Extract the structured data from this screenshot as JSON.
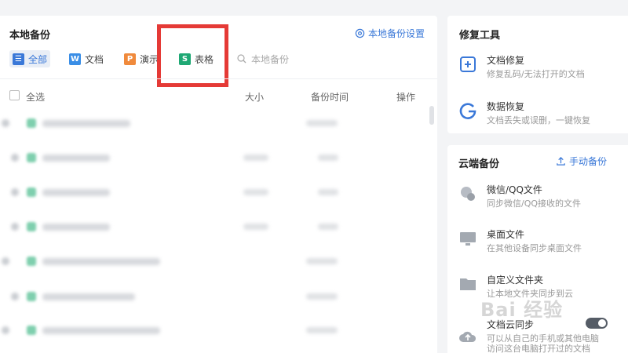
{
  "main": {
    "title": "本地备份",
    "settings_link": "本地备份设置",
    "tabs": [
      {
        "label": "全部",
        "icon_letter": "☰",
        "color": "#3a78d8",
        "active": true
      },
      {
        "label": "文档",
        "icon_letter": "W",
        "color": "#3a8ee6",
        "active": false
      },
      {
        "label": "演示",
        "icon_letter": "P",
        "color": "#f08a3c",
        "active": false
      },
      {
        "label": "表格",
        "icon_letter": "S",
        "color": "#1fa874",
        "active": false
      }
    ],
    "search_placeholder": "本地备份",
    "columns": {
      "select_all": "全选",
      "size": "大小",
      "time": "备份时间",
      "action": "操作"
    }
  },
  "repair": {
    "title": "修复工具",
    "items": [
      {
        "name": "文档修复",
        "desc": "修复乱码/无法打开的文档",
        "icon": "document-repair-icon"
      },
      {
        "name": "数据恢复",
        "desc": "文档丢失或误删，一键恢复",
        "icon": "data-recovery-icon"
      }
    ]
  },
  "cloud": {
    "title": "云端备份",
    "manual_link": "手动备份",
    "items": [
      {
        "name": "微信/QQ文件",
        "desc": "同步微信/QQ接收的文件",
        "icon": "chat-files-icon"
      },
      {
        "name": "桌面文件",
        "desc": "在其他设备同步桌面文件",
        "icon": "desktop-icon"
      },
      {
        "name": "自定义文件夹",
        "desc": "让本地文件夹同步到云",
        "icon": "folder-icon"
      },
      {
        "name": "文档云同步",
        "desc": "可以从自己的手机或其他电脑",
        "desc2": "访问这台电脑打开过的文档",
        "icon": "cloud-upload-icon"
      }
    ]
  },
  "watermark": "Bai 经验",
  "colors": {
    "accent": "#3a78d8",
    "highlight_box": "#e53a36"
  }
}
